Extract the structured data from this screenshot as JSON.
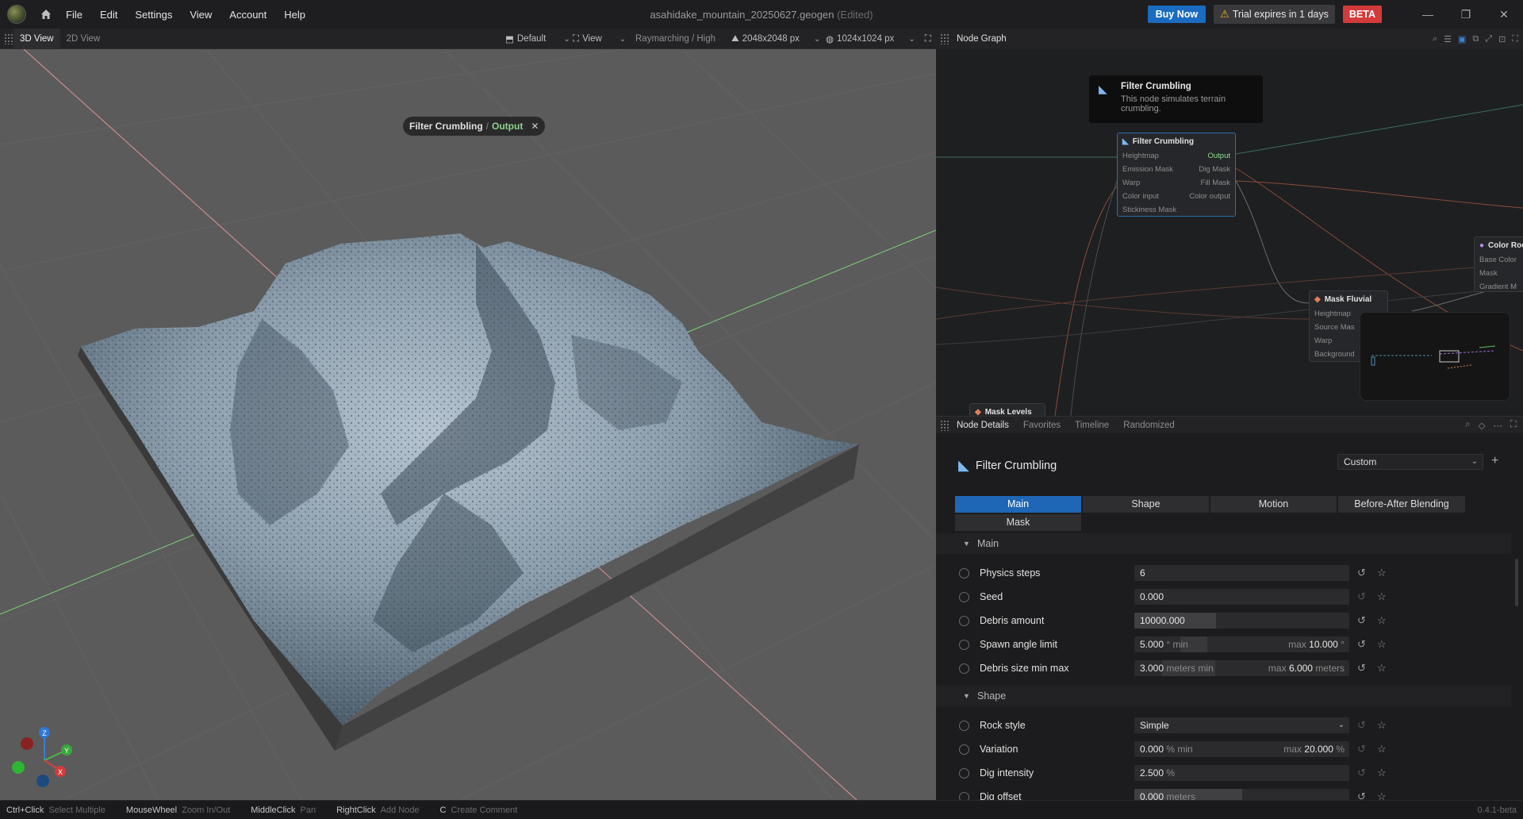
{
  "menubar": {
    "items": [
      "File",
      "Edit",
      "Settings",
      "View",
      "Account",
      "Help"
    ],
    "title": "asahidake_mountain_20250627.geogen",
    "title_status": "(Edited)",
    "buy_now": "Buy Now",
    "trial": "Trial expires in 1 days",
    "beta": "BETA"
  },
  "viewport_toolbar": {
    "tabs": [
      "3D View",
      "2D View"
    ],
    "camera": "Default",
    "view": "View",
    "render_mode": "Raymarching / High",
    "heightmap_res": "2048x2048 px",
    "texture_res": "1024x1024 px"
  },
  "viewport": {
    "tag_node": "Filter Crumbling",
    "tag_sep": "/",
    "tag_port": "Output",
    "gizmo": {
      "z": "Z",
      "y": "Y",
      "x": "X"
    }
  },
  "node_graph": {
    "title": "Node Graph",
    "tooltip": {
      "title": "Filter Crumbling",
      "body": "This node simulates terrain crumbling."
    },
    "filter_node": {
      "title": "Filter Crumbling",
      "inputs": [
        "Heightmap",
        "Emission Mask",
        "Warp",
        "Color input",
        "Stickiness Mask"
      ],
      "outputs": [
        "Output",
        "Dig Mask",
        "Fill Mask",
        "Color output"
      ]
    },
    "color_node": {
      "title": "Color Roc",
      "inputs": [
        "Base Color",
        "Mask",
        "Gradient M"
      ]
    },
    "fluvial_node": {
      "title": "Mask Fluvial",
      "inputs": [
        "Heightmap",
        "Source Mas",
        "Warp",
        "Background"
      ]
    },
    "levels_node": {
      "title": "Mask Levels"
    }
  },
  "details": {
    "tabs": [
      "Node Details",
      "Favorites",
      "Timeline",
      "Randomized"
    ],
    "node_title": "Filter Crumbling",
    "preset": "Custom",
    "param_tabs": [
      "Main",
      "Shape",
      "Motion",
      "Before-After Blending",
      "Mask"
    ],
    "section_main": "Main",
    "section_shape": "Shape",
    "params": {
      "physics_steps": {
        "label": "Physics steps",
        "value": "6"
      },
      "seed": {
        "label": "Seed",
        "value": "0.000"
      },
      "debris_amount": {
        "label": "Debris amount",
        "value": "10000.000",
        "fill": 0.38
      },
      "spawn_angle": {
        "label": "Spawn angle limit",
        "min": "5.000",
        "min_unit": "° min",
        "max_label": "max",
        "max": "10.000",
        "max_unit": "°"
      },
      "debris_size": {
        "label": "Debris size min max",
        "min": "3.000",
        "min_unit": "meters min",
        "max_label": "max",
        "max": "6.000",
        "max_unit": "meters"
      },
      "rock_style": {
        "label": "Rock style",
        "value": "Simple"
      },
      "variation": {
        "label": "Variation",
        "min": "0.000",
        "min_unit": "% min",
        "max_label": "max",
        "max": "20.000",
        "max_unit": "%"
      },
      "dig_intensity": {
        "label": "Dig intensity",
        "value": "2.500",
        "unit": "%"
      },
      "dig_offset": {
        "label": "Dig offset",
        "value": "0.000",
        "unit": "meters",
        "fill": 0.5
      }
    }
  },
  "statusbar": {
    "hints": [
      {
        "key": "Ctrl+Click",
        "action": "Select Multiple"
      },
      {
        "key": "MouseWheel",
        "action": "Zoom In/Out"
      },
      {
        "key": "MiddleClick",
        "action": "Pan"
      },
      {
        "key": "RightClick",
        "action": "Add Node"
      },
      {
        "key": "C",
        "action": "Create Comment"
      }
    ],
    "version": "0.4.1-beta"
  }
}
